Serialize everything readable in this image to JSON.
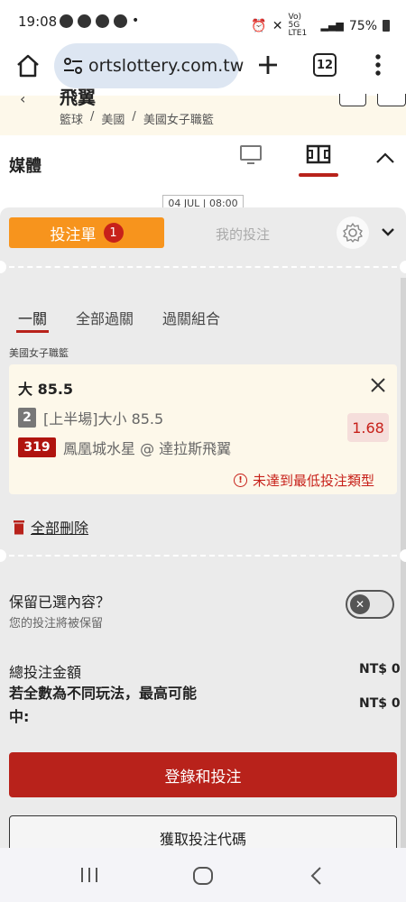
{
  "status_bar": {
    "time": "19:08",
    "network": "Vo) 5G LTE1",
    "battery": "75%"
  },
  "browser": {
    "url": "ortslottery.com.tw",
    "tab_count": "12"
  },
  "page_header": {
    "title": "飛翼",
    "breadcrumb": [
      "籃球",
      "美國",
      "美國女子職籃"
    ]
  },
  "media_row": {
    "label": "媒體",
    "date_chip": "04 JUL | 08:00"
  },
  "betslip": {
    "tab_active": "投注單",
    "tab_count": "1",
    "tab_inactive": "我的投注",
    "subtabs": [
      "一關",
      "全部過關",
      "過關組合"
    ],
    "league": "美國女子職籃",
    "selection": {
      "title": "大 85.5",
      "market_num": "2",
      "market": "[上半場]大小 85.5",
      "match_id": "319",
      "match": "鳳凰城水星 @ 達拉斯飛翼",
      "odds": "1.68",
      "warning": "未達到最低投注類型"
    },
    "delete_all": "全部刪除",
    "keep_title": "保留已選內容？",
    "keep_subtitle": "您的投注將被保留",
    "total_label": "總投注金額",
    "total_value": "NT$ 0",
    "max_win_label": "若全數為不同玩法，最高可能中:",
    "max_win_value": "NT$ 0",
    "login_button": "登錄和投注",
    "code_button": "獲取投注代碼"
  },
  "colors": {
    "orange": "#f7941d",
    "red": "#b8221b",
    "cream": "#fdf8ea"
  }
}
